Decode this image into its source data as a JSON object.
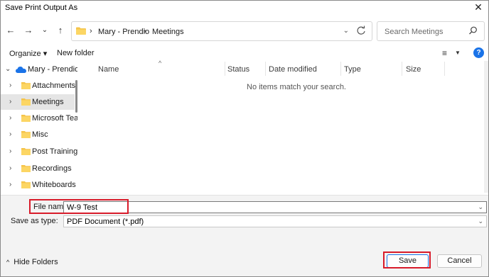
{
  "window": {
    "title": "Save Print Output As",
    "close": "✕"
  },
  "nav": {
    "back": "←",
    "forward": "→",
    "recent": "⌄",
    "up": "↑",
    "breadcrumb": [
      "Mary - Prendio",
      "Meetings"
    ],
    "breadcrumb_sep": "›",
    "search_placeholder": "Search Meetings"
  },
  "commands": {
    "organize": "Organize ▾",
    "new_folder": "New folder",
    "help": "?"
  },
  "sidebar": {
    "root": "Mary - Prendio",
    "items": [
      {
        "label": "Attachments",
        "selected": false
      },
      {
        "label": "Meetings",
        "selected": true
      },
      {
        "label": "Microsoft Team",
        "selected": false
      },
      {
        "label": "Misc",
        "selected": false
      },
      {
        "label": "Post Training S",
        "selected": false
      },
      {
        "label": "Recordings",
        "selected": false
      },
      {
        "label": "Whiteboards",
        "selected": false
      }
    ]
  },
  "columns": [
    "Name",
    "Status",
    "Date modified",
    "Type",
    "Size"
  ],
  "empty_message": "No items match your search.",
  "form": {
    "file_name_label": "File name:",
    "file_name_value": "W-9 Test",
    "save_as_type_label": "Save as type:",
    "save_as_type_value": "PDF Document (*.pdf)"
  },
  "footer": {
    "hide_folders": "Hide Folders",
    "save": "Save",
    "cancel": "Cancel"
  },
  "colors": {
    "highlight": "#d81b2a",
    "folder": "#f5c44a",
    "help": "#1a73e8",
    "cloud": "#1a73e8"
  }
}
